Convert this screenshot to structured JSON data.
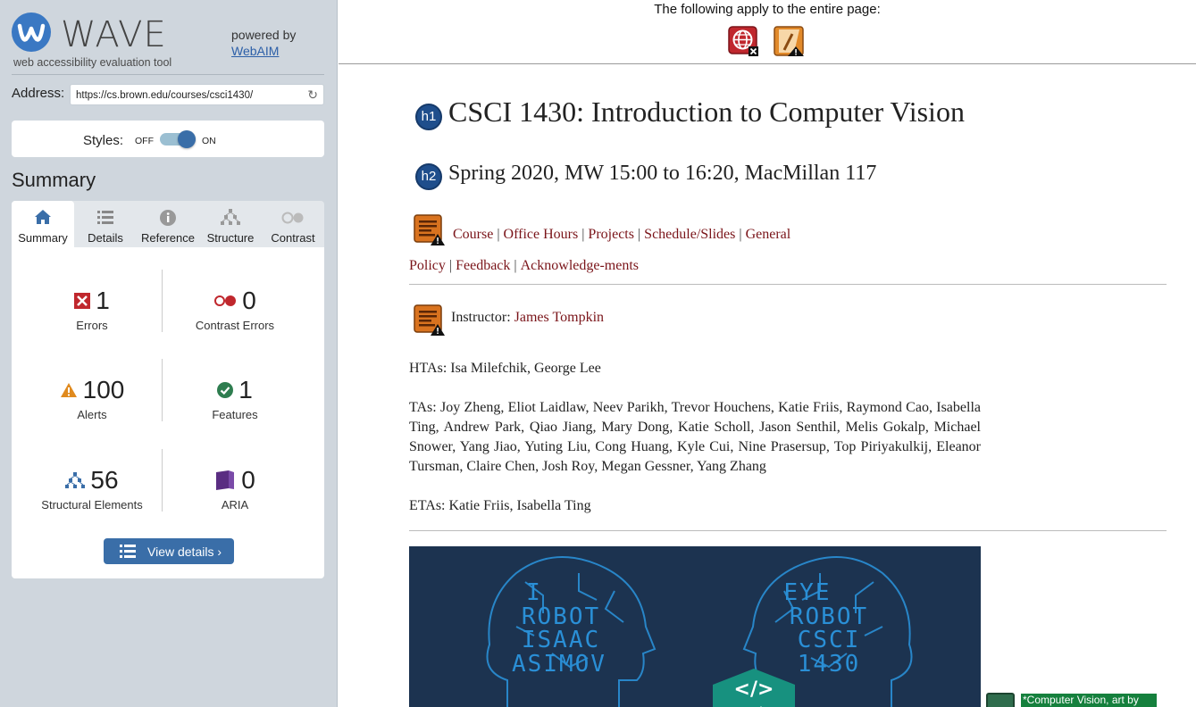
{
  "sidebar": {
    "brand": "WAVE",
    "tagline": "web accessibility evaluation tool",
    "powered_by": "powered by",
    "webaim_link": "WebAIM",
    "address_label": "Address:",
    "address_value": "https://cs.brown.edu/courses/csci1430/",
    "styles_label": "Styles:",
    "styles_off": "OFF",
    "styles_on": "ON",
    "summary_title": "Summary",
    "tabs": [
      {
        "label": "Summary",
        "icon": "home-icon",
        "active": true
      },
      {
        "label": "Details",
        "icon": "list-icon",
        "active": false
      },
      {
        "label": "Reference",
        "icon": "info-icon",
        "active": false
      },
      {
        "label": "Structure",
        "icon": "structure-icon",
        "active": false
      },
      {
        "label": "Contrast",
        "icon": "contrast-icon",
        "active": false
      }
    ],
    "stats": {
      "errors": {
        "count": "1",
        "label": "Errors"
      },
      "contrast_errors": {
        "count": "0",
        "label": "Contrast Errors"
      },
      "alerts": {
        "count": "100",
        "label": "Alerts"
      },
      "features": {
        "count": "1",
        "label": "Features"
      },
      "structural": {
        "count": "56",
        "label": "Structural Elements"
      },
      "aria": {
        "count": "0",
        "label": "ARIA"
      }
    },
    "view_details": "View details ›"
  },
  "topbar": {
    "text": "The following apply to the entire page:"
  },
  "content": {
    "h1_badge": "h1",
    "h1": "CSCI 1430: Introduction to Computer Vision",
    "h2_badge": "h2",
    "h2": "Spring 2020, MW 15:00 to 16:20, MacMillan 117",
    "nav_links": [
      "Course",
      "Office Hours",
      "Projects",
      "Schedule/Slides",
      "General Policy",
      "Feedback",
      "Acknowledge-ments"
    ],
    "instructor_label": "Instructor:",
    "instructor_name": "James Tompkin",
    "htas": "HTAs: Isa Milefchik, George Lee",
    "tas": "TAs: Joy Zheng, Eliot Laidlaw, Neev Parikh, Trevor Houchens, Katie Friis, Raymond Cao, Isabella Ting, Andrew Park, Qiao Jiang, Mary Dong, Katie Scholl, Jason Senthil, Melis Gokalp, Michael Snower, Yang Jiao, Yuting Liu, Cong Huang, Kyle Cui, Nine Prasersup, Top Piriyakulkij, Eleanor Tursman, Claire Chen, Josh Roy, Megan Gessner, Yang Zhang",
    "etas": "ETAs: Katie Friis, Isabella Ting",
    "banner": {
      "left_words": [
        "I",
        "ROBOT",
        "ISAAC",
        "ASIMOV"
      ],
      "right_words": [
        "EYE",
        "ROBOT",
        "CSCI",
        "1430"
      ],
      "code_badge_symbol": "</>",
      "code_badge_label": "Code"
    },
    "art_tag": "*Computer Vision, art by"
  }
}
